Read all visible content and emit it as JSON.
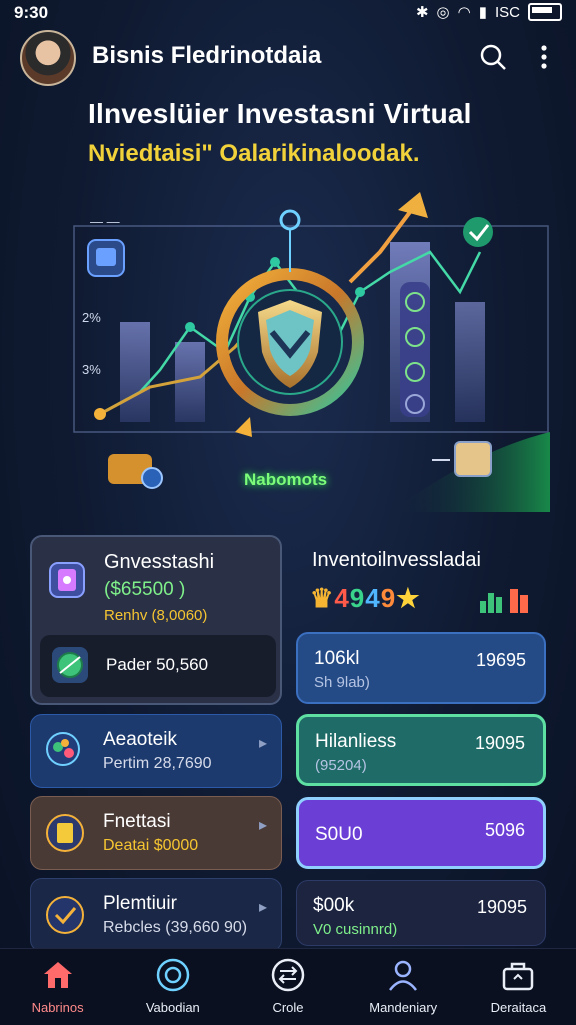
{
  "status_bar": {
    "time": "9:30",
    "signal_text": "ISC",
    "icons": [
      "bluetooth-icon",
      "alarm-icon",
      "wifi-icon",
      "signal-icon",
      "battery-icon"
    ]
  },
  "header": {
    "title": "Bisnis Fledrinotdaia",
    "avatar": "avatar-photo"
  },
  "headline": "Ilnveslüier Investasni Virtual",
  "subheadline": "Nviedtaisi\" Oalarikinaloodak.",
  "hero": {
    "label": "Nabomots",
    "ticks": [
      "2%",
      "3%"
    ]
  },
  "left_main": {
    "title": "Gnvesstashi",
    "amount": "($65500 )",
    "sub": "Renhv (8,0060)",
    "inner_text": "Pader 50,560"
  },
  "left_cards": [
    {
      "title": "Aeaoteik",
      "sub": "Pertim 28,7690",
      "theme": "blue"
    },
    {
      "title": "Fnettasi",
      "sub": "Deatai  $0000",
      "theme": "brown"
    },
    {
      "title": "Plemtiuir",
      "sub": "Rebcles (39,660 90)",
      "theme": "navy"
    }
  ],
  "right_head": {
    "title": "Inventoilnvessladai",
    "code": [
      "4",
      "9",
      "4",
      "9"
    ]
  },
  "right_cards": [
    {
      "title": "106kl",
      "sub": "Sh 9lab)",
      "value": "19695",
      "theme": "blue"
    },
    {
      "title": "Hilanliess",
      "sub": "(95204)",
      "value": "19095",
      "theme": "teal"
    },
    {
      "title": "S0U0",
      "sub": "",
      "value": "5096",
      "theme": "purple"
    },
    {
      "title": "$00k",
      "sub": "V0 cusinnrd)",
      "value": "19095",
      "theme": "dark"
    }
  ],
  "nav": [
    {
      "label": "Nabrinos",
      "icon": "home-icon",
      "active": true
    },
    {
      "label": "Vabodian",
      "icon": "target-icon",
      "active": false
    },
    {
      "label": "Crole",
      "icon": "exchange-icon",
      "active": false
    },
    {
      "label": "Mandeniary",
      "icon": "person-icon",
      "active": false
    },
    {
      "label": "Deraitaca",
      "icon": "briefcase-icon",
      "active": false
    }
  ],
  "colors": {
    "bg": "#0f1a31",
    "accent_green": "#7dfc7a",
    "accent_yellow": "#f2d23a",
    "purple": "#6b3fd6",
    "teal": "#1f6b67",
    "nav_active": "#ff6a6a"
  }
}
